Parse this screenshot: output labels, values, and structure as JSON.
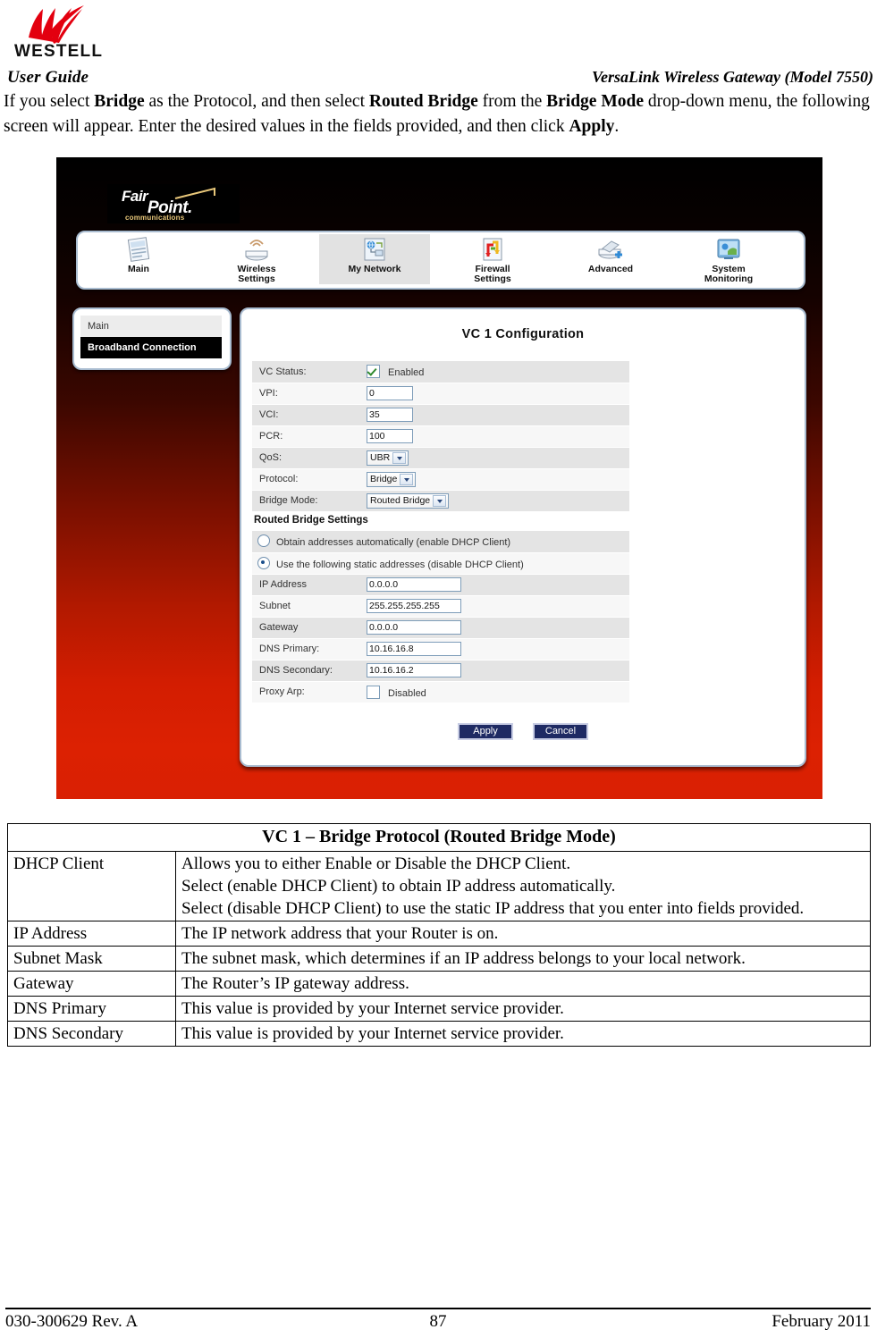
{
  "header": {
    "logo_alt": "WESTELL",
    "logo_wordmark": "WESTELL",
    "guide_label": "User Guide",
    "product_label": "VersaLink Wireless Gateway (Model 7550)",
    "intro_html": "If you select <b>Bridge</b> as the Protocol, and then select <b>Routed Bridge</b> from the <b>Bridge Mode</b> drop-down menu, the following screen will appear. Enter the desired values in the fields provided, and then click <b>Apply</b>."
  },
  "screenshot": {
    "brand": {
      "fair": "Fair",
      "point": "Point.",
      "tagline": "communications"
    },
    "nav": [
      {
        "label_line1": "Main",
        "label_line2": "",
        "icon": "document-page-icon",
        "active": false
      },
      {
        "label_line1": "Wireless",
        "label_line2": "Settings",
        "icon": "wireless-antenna-icon",
        "active": false
      },
      {
        "label_line1": "My Network",
        "label_line2": "",
        "icon": "network-globe-icon",
        "active": true
      },
      {
        "label_line1": "Firewall",
        "label_line2": "Settings",
        "icon": "firewall-arrows-icon",
        "active": false
      },
      {
        "label_line1": "Advanced",
        "label_line2": "",
        "icon": "advanced-gear-icon",
        "active": false
      },
      {
        "label_line1": "System",
        "label_line2": "Monitoring",
        "icon": "monitor-screen-icon",
        "active": false
      }
    ],
    "sidebar": {
      "items": [
        {
          "label": "Main",
          "selected": false
        },
        {
          "label": "Broadband Connection",
          "selected": true
        }
      ]
    },
    "panel": {
      "title": "VC 1 Configuration",
      "vc_rows": [
        {
          "label": "VC Status:",
          "control": "checkbox",
          "value": "Enabled",
          "checked": true
        },
        {
          "label": "VPI:",
          "control": "text",
          "value": "0",
          "size": "small"
        },
        {
          "label": "VCI:",
          "control": "text",
          "value": "35",
          "size": "small"
        },
        {
          "label": "PCR:",
          "control": "text",
          "value": "100",
          "size": "small"
        },
        {
          "label": "QoS:",
          "control": "select",
          "value": "UBR"
        },
        {
          "label": "Protocol:",
          "control": "select",
          "value": "Bridge"
        },
        {
          "label": "Bridge Mode:",
          "control": "select",
          "value": "Routed Bridge"
        }
      ],
      "section_title": "Routed Bridge Settings",
      "radios": [
        {
          "label": "Obtain addresses automatically (enable DHCP Client)",
          "selected": false
        },
        {
          "label": "Use the following static addresses (disable DHCP Client)",
          "selected": true
        }
      ],
      "rb_rows": [
        {
          "label": "IP Address",
          "control": "text",
          "value": "0.0.0.0"
        },
        {
          "label": "Subnet",
          "control": "text",
          "value": "255.255.255.255"
        },
        {
          "label": "Gateway",
          "control": "text",
          "value": "0.0.0.0"
        },
        {
          "label": "DNS Primary:",
          "control": "text",
          "value": "10.16.16.8"
        },
        {
          "label": "DNS Secondary:",
          "control": "text",
          "value": "10.16.16.2"
        },
        {
          "label": "Proxy Arp:",
          "control": "checkbox",
          "value": "Disabled",
          "checked": false
        }
      ],
      "buttons": {
        "apply": "Apply",
        "cancel": "Cancel"
      }
    },
    "colors": {
      "background_top": "#000000",
      "background_bottom": "#d92003",
      "accent_button": "#1e2a63",
      "selected_item": "#000000"
    }
  },
  "desc_table": {
    "caption": "VC 1 – Bridge Protocol (Routed Bridge Mode)",
    "rows": [
      {
        "key": "DHCP Client",
        "lines": [
          "Allows you to either Enable or Disable the DHCP Client.",
          "Select (enable DHCP Client) to obtain IP address automatically.",
          "Select (disable DHCP Client) to use the static IP address that you enter into fields provided."
        ]
      },
      {
        "key": "IP Address",
        "lines": [
          "The IP network address that your Router is on."
        ]
      },
      {
        "key": "Subnet Mask",
        "lines": [
          "The subnet mask, which determines if an IP address belongs to your local network."
        ]
      },
      {
        "key": "Gateway",
        "lines": [
          "The Router’s IP gateway address."
        ]
      },
      {
        "key": "DNS Primary",
        "lines": [
          "This value is provided by your Internet service provider."
        ]
      },
      {
        "key": "DNS Secondary",
        "lines": [
          "This value is provided by your Internet service provider."
        ]
      }
    ]
  },
  "footer": {
    "doc_number": "030-300629 Rev. A",
    "page_number": "87",
    "date": "February 2011"
  }
}
